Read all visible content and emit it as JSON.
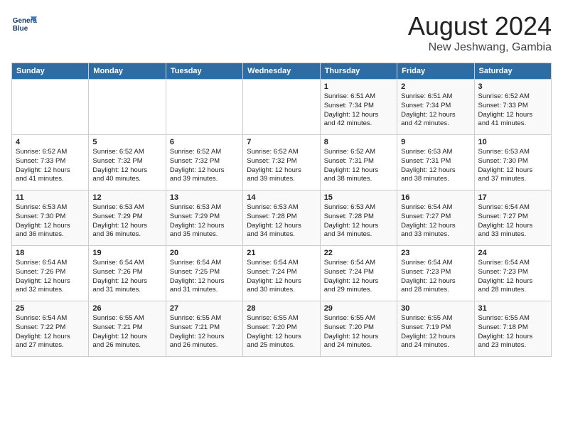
{
  "header": {
    "logo_line1": "General",
    "logo_line2": "Blue",
    "title": "August 2024",
    "subtitle": "New Jeshwang, Gambia"
  },
  "days_of_week": [
    "Sunday",
    "Monday",
    "Tuesday",
    "Wednesday",
    "Thursday",
    "Friday",
    "Saturday"
  ],
  "weeks": [
    [
      {
        "day": "",
        "info": ""
      },
      {
        "day": "",
        "info": ""
      },
      {
        "day": "",
        "info": ""
      },
      {
        "day": "",
        "info": ""
      },
      {
        "day": "1",
        "info": "Sunrise: 6:51 AM\nSunset: 7:34 PM\nDaylight: 12 hours\nand 42 minutes."
      },
      {
        "day": "2",
        "info": "Sunrise: 6:51 AM\nSunset: 7:34 PM\nDaylight: 12 hours\nand 42 minutes."
      },
      {
        "day": "3",
        "info": "Sunrise: 6:52 AM\nSunset: 7:33 PM\nDaylight: 12 hours\nand 41 minutes."
      }
    ],
    [
      {
        "day": "4",
        "info": "Sunrise: 6:52 AM\nSunset: 7:33 PM\nDaylight: 12 hours\nand 41 minutes."
      },
      {
        "day": "5",
        "info": "Sunrise: 6:52 AM\nSunset: 7:32 PM\nDaylight: 12 hours\nand 40 minutes."
      },
      {
        "day": "6",
        "info": "Sunrise: 6:52 AM\nSunset: 7:32 PM\nDaylight: 12 hours\nand 39 minutes."
      },
      {
        "day": "7",
        "info": "Sunrise: 6:52 AM\nSunset: 7:32 PM\nDaylight: 12 hours\nand 39 minutes."
      },
      {
        "day": "8",
        "info": "Sunrise: 6:52 AM\nSunset: 7:31 PM\nDaylight: 12 hours\nand 38 minutes."
      },
      {
        "day": "9",
        "info": "Sunrise: 6:53 AM\nSunset: 7:31 PM\nDaylight: 12 hours\nand 38 minutes."
      },
      {
        "day": "10",
        "info": "Sunrise: 6:53 AM\nSunset: 7:30 PM\nDaylight: 12 hours\nand 37 minutes."
      }
    ],
    [
      {
        "day": "11",
        "info": "Sunrise: 6:53 AM\nSunset: 7:30 PM\nDaylight: 12 hours\nand 36 minutes."
      },
      {
        "day": "12",
        "info": "Sunrise: 6:53 AM\nSunset: 7:29 PM\nDaylight: 12 hours\nand 36 minutes."
      },
      {
        "day": "13",
        "info": "Sunrise: 6:53 AM\nSunset: 7:29 PM\nDaylight: 12 hours\nand 35 minutes."
      },
      {
        "day": "14",
        "info": "Sunrise: 6:53 AM\nSunset: 7:28 PM\nDaylight: 12 hours\nand 34 minutes."
      },
      {
        "day": "15",
        "info": "Sunrise: 6:53 AM\nSunset: 7:28 PM\nDaylight: 12 hours\nand 34 minutes."
      },
      {
        "day": "16",
        "info": "Sunrise: 6:54 AM\nSunset: 7:27 PM\nDaylight: 12 hours\nand 33 minutes."
      },
      {
        "day": "17",
        "info": "Sunrise: 6:54 AM\nSunset: 7:27 PM\nDaylight: 12 hours\nand 33 minutes."
      }
    ],
    [
      {
        "day": "18",
        "info": "Sunrise: 6:54 AM\nSunset: 7:26 PM\nDaylight: 12 hours\nand 32 minutes."
      },
      {
        "day": "19",
        "info": "Sunrise: 6:54 AM\nSunset: 7:26 PM\nDaylight: 12 hours\nand 31 minutes."
      },
      {
        "day": "20",
        "info": "Sunrise: 6:54 AM\nSunset: 7:25 PM\nDaylight: 12 hours\nand 31 minutes."
      },
      {
        "day": "21",
        "info": "Sunrise: 6:54 AM\nSunset: 7:24 PM\nDaylight: 12 hours\nand 30 minutes."
      },
      {
        "day": "22",
        "info": "Sunrise: 6:54 AM\nSunset: 7:24 PM\nDaylight: 12 hours\nand 29 minutes."
      },
      {
        "day": "23",
        "info": "Sunrise: 6:54 AM\nSunset: 7:23 PM\nDaylight: 12 hours\nand 28 minutes."
      },
      {
        "day": "24",
        "info": "Sunrise: 6:54 AM\nSunset: 7:23 PM\nDaylight: 12 hours\nand 28 minutes."
      }
    ],
    [
      {
        "day": "25",
        "info": "Sunrise: 6:54 AM\nSunset: 7:22 PM\nDaylight: 12 hours\nand 27 minutes."
      },
      {
        "day": "26",
        "info": "Sunrise: 6:55 AM\nSunset: 7:21 PM\nDaylight: 12 hours\nand 26 minutes."
      },
      {
        "day": "27",
        "info": "Sunrise: 6:55 AM\nSunset: 7:21 PM\nDaylight: 12 hours\nand 26 minutes."
      },
      {
        "day": "28",
        "info": "Sunrise: 6:55 AM\nSunset: 7:20 PM\nDaylight: 12 hours\nand 25 minutes."
      },
      {
        "day": "29",
        "info": "Sunrise: 6:55 AM\nSunset: 7:20 PM\nDaylight: 12 hours\nand 24 minutes."
      },
      {
        "day": "30",
        "info": "Sunrise: 6:55 AM\nSunset: 7:19 PM\nDaylight: 12 hours\nand 24 minutes."
      },
      {
        "day": "31",
        "info": "Sunrise: 6:55 AM\nSunset: 7:18 PM\nDaylight: 12 hours\nand 23 minutes."
      }
    ]
  ]
}
